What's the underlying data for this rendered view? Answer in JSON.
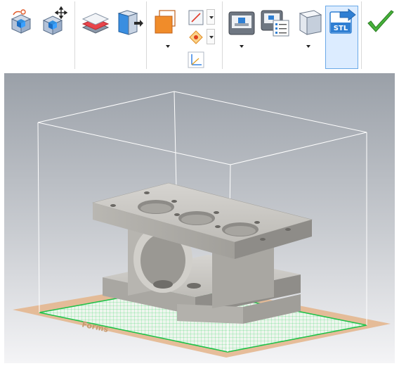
{
  "toolbar": {
    "buttons": [
      {
        "name": "rotate-model-button",
        "icon": "rotate-cube-icon"
      },
      {
        "name": "move-model-button",
        "icon": "move-cube-icon"
      },
      {
        "name": "slice-layers-button",
        "icon": "layers-icon"
      },
      {
        "name": "place-face-button",
        "icon": "cube-face-arrow-icon"
      },
      {
        "name": "scale-button",
        "icon": "scale-orange-square-icon"
      },
      {
        "name": "sketch-plane-button",
        "icon": "line-plane-icon"
      },
      {
        "name": "snap-point-button",
        "icon": "diamond-point-icon"
      },
      {
        "name": "axis-button",
        "icon": "axis-icon"
      },
      {
        "name": "printer-select-button",
        "icon": "printer-icon"
      },
      {
        "name": "printer-settings-button",
        "icon": "printer-settings-icon"
      },
      {
        "name": "view-cube-button",
        "icon": "cube-icon"
      },
      {
        "name": "export-stl-button",
        "icon": "stl-export-icon",
        "label": "STL",
        "active": true
      },
      {
        "name": "finish-button",
        "icon": "checkmark-icon"
      }
    ],
    "colors": {
      "accent": "#2f7fd3",
      "check": "#3fa535",
      "orange": "#f08c2a"
    }
  },
  "viewport": {
    "background_top": "#9aa0a8",
    "background_bottom": "#f4f4f6",
    "plate_color": "#eeeeee",
    "grid_color": "#45d36c",
    "bed_color": "#e4b48a",
    "bed_label": "Forms"
  }
}
